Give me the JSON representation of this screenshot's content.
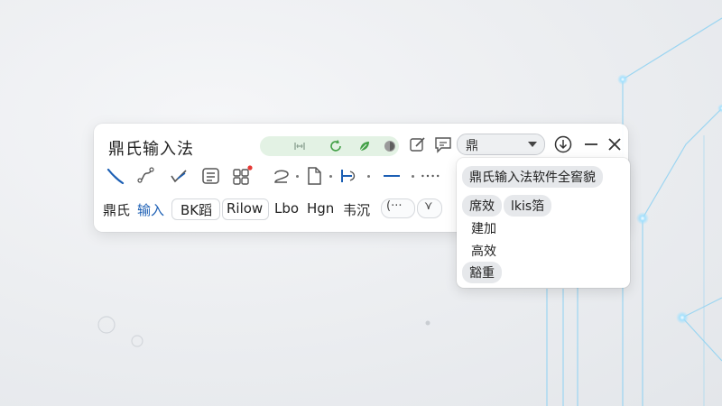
{
  "toolbar": {
    "title": "鼎氏输入法",
    "status_icons": [
      "code-icon",
      "refresh-icon",
      "leaf-icon",
      "moon-icon"
    ],
    "header_icons": [
      "edit-icon",
      "comment-icon"
    ],
    "dropdown": {
      "value": "鼎",
      "options_visible": [
        "鼎"
      ]
    },
    "window_controls": [
      "download-icon",
      "minimize-icon",
      "close-icon"
    ],
    "tool_icons": [
      "pen-icon",
      "curve-icon",
      "check-stroke-icon",
      "layers-icon",
      "apps-icon",
      "loop-icon",
      "document-icon",
      "separator-icon",
      "dash-icon",
      "dots-icon"
    ],
    "candidates": [
      {
        "text": "鼎氏",
        "highlight": false
      },
      {
        "text": "输入",
        "highlight": true
      },
      {
        "text": "BK蹈",
        "highlight": false,
        "boxed": true
      },
      {
        "text": "Rilow",
        "highlight": false,
        "boxed": true
      },
      {
        "text": "Lbo",
        "highlight": false
      },
      {
        "text": "Hgn",
        "highlight": false
      },
      {
        "text": "韦沉",
        "highlight": false
      }
    ],
    "more_button": "(···",
    "expand_button": "⋎"
  },
  "popup": {
    "items": [
      {
        "label": "鼎氏输入法软件全窖貌",
        "highlight": true
      },
      {
        "label": "席效",
        "highlight": true
      },
      {
        "label": "lkis箔",
        "highlight": true
      },
      {
        "label": "建加",
        "highlight": false
      },
      {
        "label": "高效",
        "highlight": false
      },
      {
        "label": "豁重",
        "highlight": true
      }
    ]
  },
  "colors": {
    "accent_blue": "#1c5fb4",
    "status_green": "#e3f2e4",
    "notification_red": "#e53935",
    "glow_cyan": "#7fd3ff"
  }
}
